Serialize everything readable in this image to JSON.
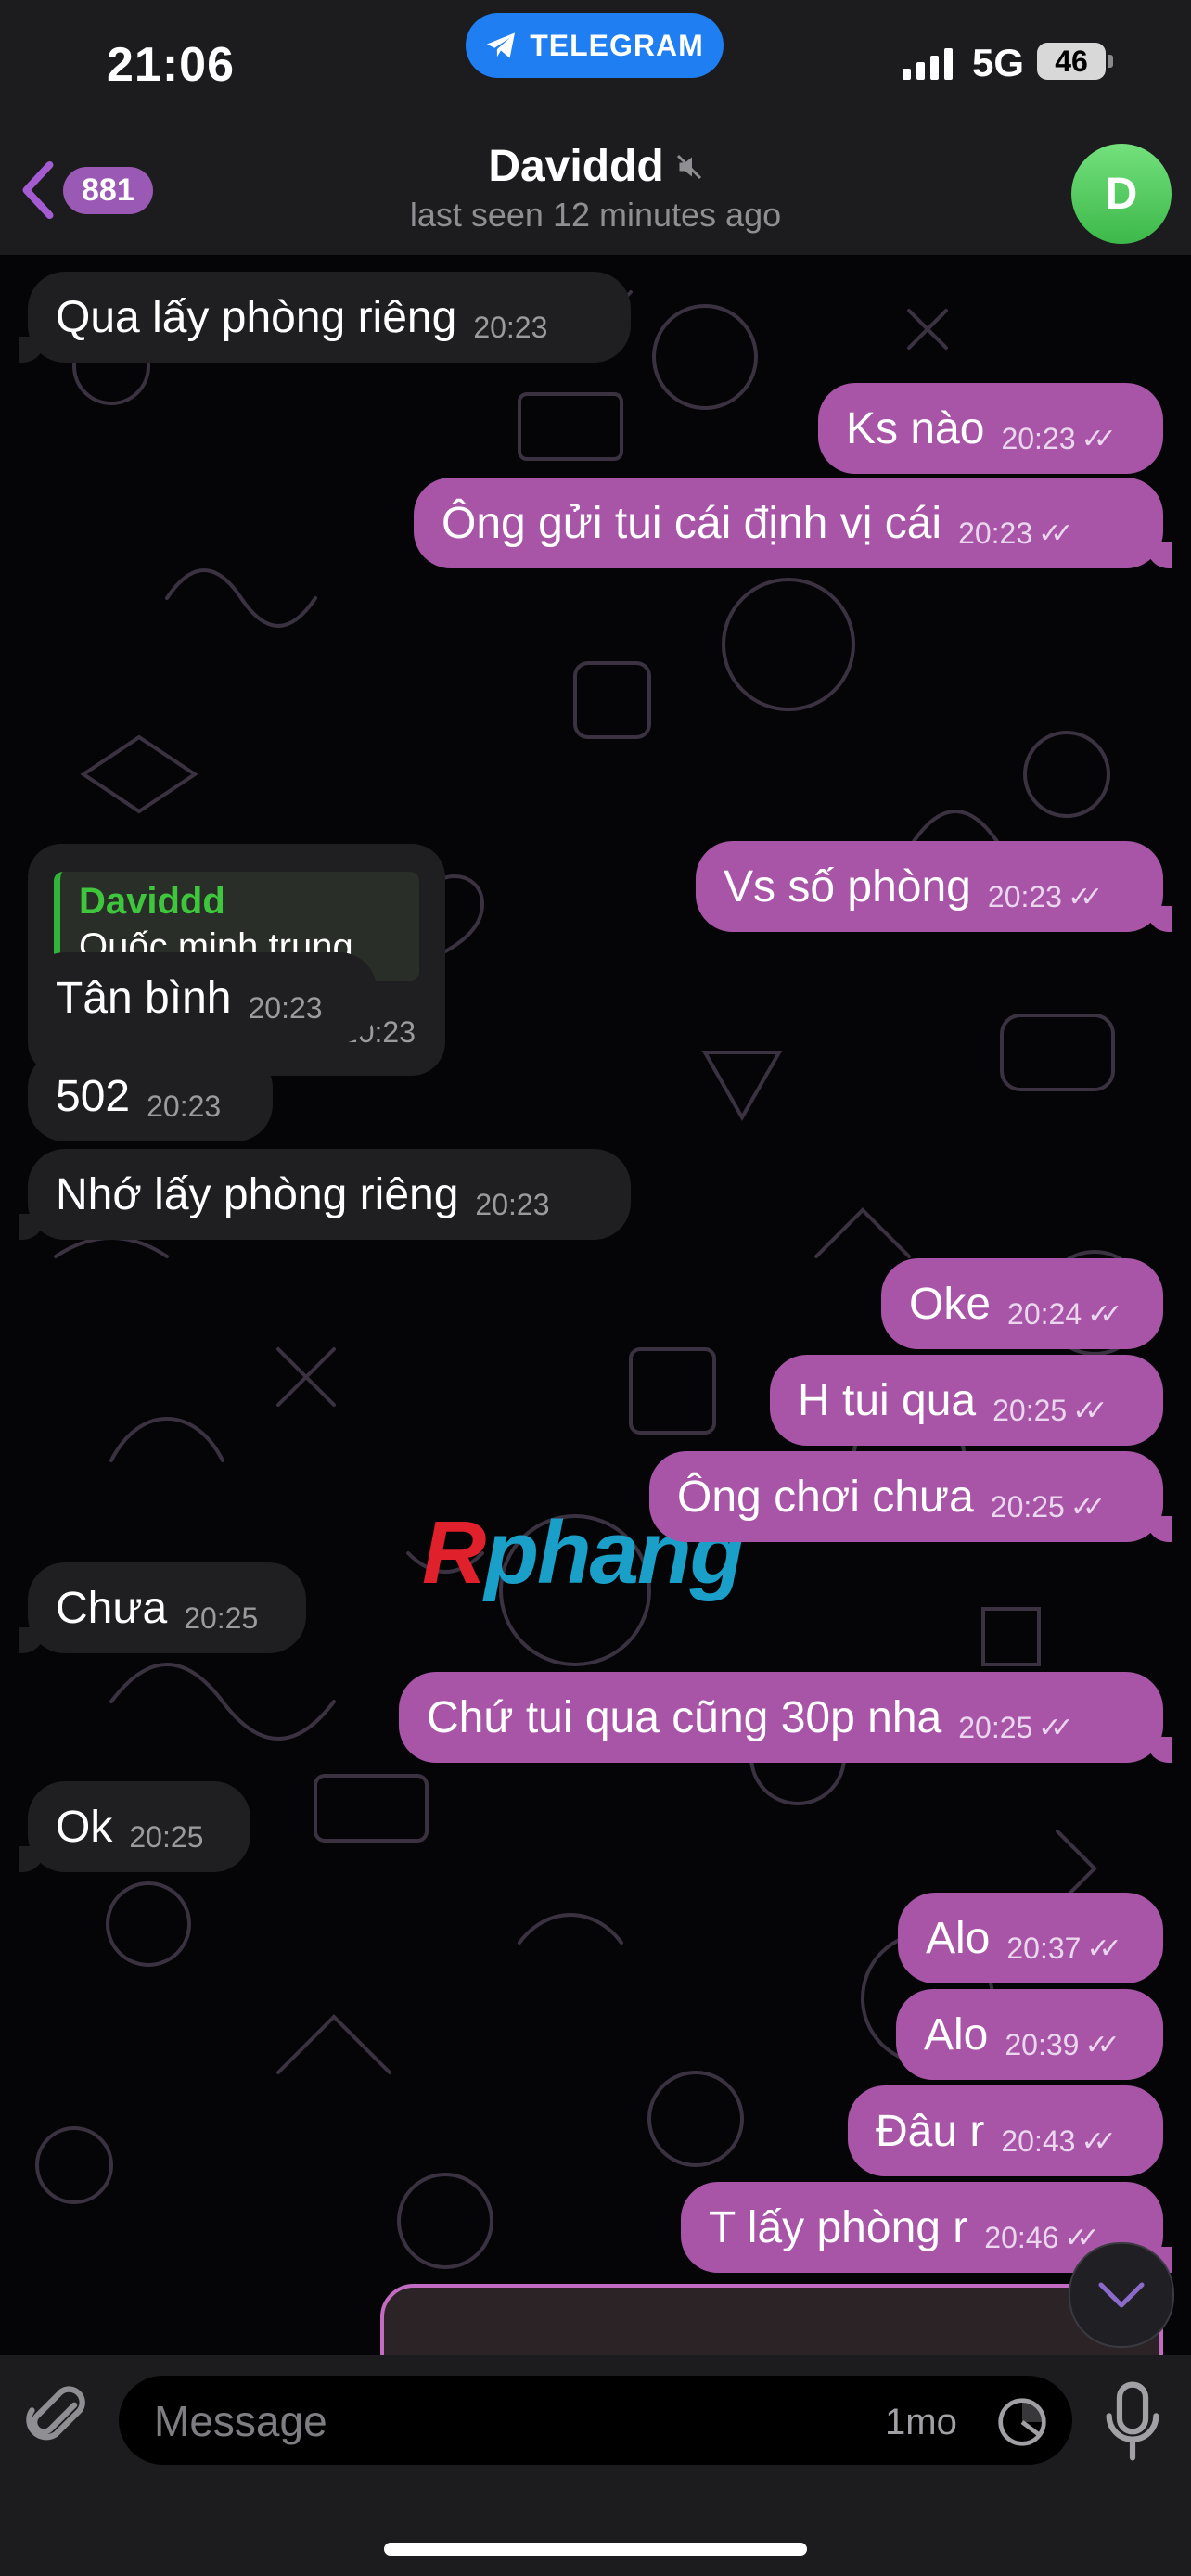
{
  "status_bar": {
    "time": "21:06",
    "app_pill": "TELEGRAM",
    "network": "5G",
    "battery": "46"
  },
  "header": {
    "back_badge": "881",
    "title": "Daviddd",
    "muted_icon": "muted-speaker-icon",
    "subtitle": "last seen 12 minutes ago",
    "avatar_initial": "D"
  },
  "messages": [
    {
      "dir": "in",
      "text": "Qua lấy phòng riêng",
      "time": "20:23"
    },
    {
      "dir": "out",
      "text": "Ks nào",
      "time": "20:23"
    },
    {
      "dir": "out",
      "text": "Ông gửi tui cái định vị cái",
      "time": "20:23"
    },
    {
      "dir": "in",
      "type": "reply",
      "quote_name": "Daviddd",
      "quote_text": "Quốc minh trung",
      "text": "•",
      "time": "20:23"
    },
    {
      "dir": "out",
      "text": "Vs số phòng",
      "time": "20:23"
    },
    {
      "dir": "in",
      "text": "Tân bình",
      "time": "20:23"
    },
    {
      "dir": "in",
      "text": "502",
      "time": "20:23"
    },
    {
      "dir": "in",
      "text": "Nhớ lấy phòng riêng",
      "time": "20:23"
    },
    {
      "dir": "out",
      "text": "Oke",
      "time": "20:24"
    },
    {
      "dir": "out",
      "text": "H tui qua",
      "time": "20:25"
    },
    {
      "dir": "out",
      "text": "Ông chơi chưa",
      "time": "20:25"
    },
    {
      "dir": "in",
      "text": "Chưa",
      "time": "20:25"
    },
    {
      "dir": "out",
      "text": "Chứ tui qua cũng 30p nha",
      "time": "20:25"
    },
    {
      "dir": "in",
      "text": "Ok",
      "time": "20:25"
    },
    {
      "dir": "out",
      "text": "Alo",
      "time": "20:37"
    },
    {
      "dir": "out",
      "text": "Alo",
      "time": "20:39"
    },
    {
      "dir": "out",
      "text": "Đâu r",
      "time": "20:43"
    },
    {
      "dir": "out",
      "text": "T lấy phòng r",
      "time": "20:46"
    }
  ],
  "read_checks": "✓✓",
  "watermark": {
    "first": "R",
    "rest": "phang"
  },
  "composer": {
    "placeholder": "Message",
    "timer_label": "1mo"
  },
  "colors": {
    "outgoing_bubble": "#a855a8",
    "incoming_bubble": "#1f1f22",
    "badge": "#9b59b6",
    "quote_name": "#3ec63c",
    "telegram_pill": "#1e7ef2"
  }
}
